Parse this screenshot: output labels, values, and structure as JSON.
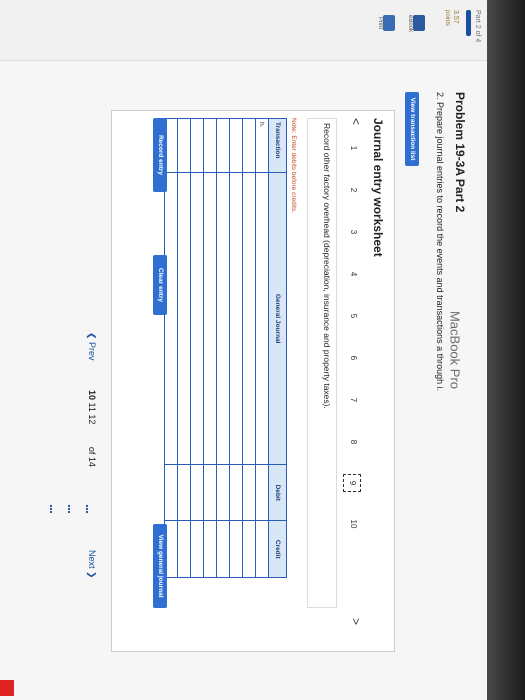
{
  "app": {
    "part_label": "Part 2 of 4",
    "points_value": "3.57",
    "points_unit": "points",
    "title": "Problem 19-3A Part 2",
    "question": "2. Prepare journal entries to record the events and transactions a through i.",
    "view_transaction_list": "View transaction list"
  },
  "rail": {
    "ebook_label": "eBook",
    "print_label": "Print"
  },
  "worksheet": {
    "title": "Journal entry worksheet",
    "nav_numbers": [
      "1",
      "2",
      "3",
      "4",
      "5",
      "6",
      "7",
      "8",
      "9",
      "10"
    ],
    "active_number": "9",
    "prev_arrow": "<",
    "next_arrow": ">",
    "description": "Record other factory overhead (depreciation, insurance and property taxes).",
    "note": "Note: Enter debits before credits.",
    "columns": [
      "Transaction",
      "General Journal",
      "Debit",
      "Credit"
    ],
    "rows": [
      [
        "h.",
        "",
        "",
        ""
      ],
      [
        "",
        "",
        "",
        ""
      ],
      [
        "",
        "",
        "",
        ""
      ],
      [
        "",
        "",
        "",
        ""
      ],
      [
        "",
        "",
        "",
        ""
      ],
      [
        "",
        "",
        "",
        ""
      ],
      [
        "",
        "",
        "",
        ""
      ],
      [
        "",
        "",
        "",
        ""
      ]
    ],
    "record_entry": "Record entry",
    "clear_entry": "Clear entry",
    "view_general_journal": "View general journal"
  },
  "footer": {
    "prev": "Prev",
    "page_a": "10",
    "page_b": "11",
    "page_c": "12",
    "of_label": "of 14",
    "next": "Next"
  },
  "device": {
    "brand": "MacBook Pro"
  },
  "colors": {
    "accent": "#2f6fd2",
    "table_border": "#2a5cb8",
    "note": "#c54a2a"
  }
}
